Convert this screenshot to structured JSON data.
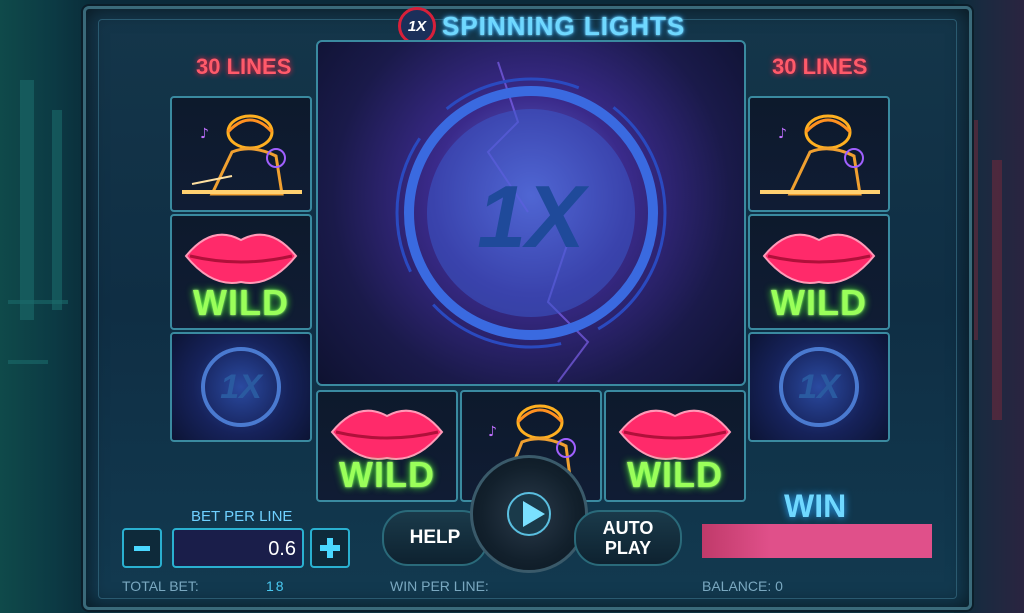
{
  "game": {
    "title": "SPINNING LIGHTS",
    "logo_text": "1X",
    "lines_left": "30 LINES",
    "lines_right": "30 LINES"
  },
  "reels": {
    "wild_label": "WILD",
    "center_logo": "1X",
    "mini_logo": "1X",
    "symbols": [
      "dj-symbol",
      "lips-wild-symbol",
      "logo-symbol"
    ]
  },
  "controls": {
    "bet_per_line_label": "BET PER LINE",
    "bet_value": "0.6",
    "help_label": "HELP",
    "auto_label_1": "AUTO",
    "auto_label_2": "PLAY",
    "win_label": "WIN"
  },
  "status": {
    "total_bet_label": "TOTAL BET:",
    "total_bet_value": "18",
    "win_per_line_label": "WIN PER LINE:",
    "balance_label": "BALANCE: 0"
  },
  "colors": {
    "accent": "#6fd8ff",
    "lines": "#ff5a6a",
    "wild": "#9aff5a",
    "win_bar": "#e0508a"
  }
}
